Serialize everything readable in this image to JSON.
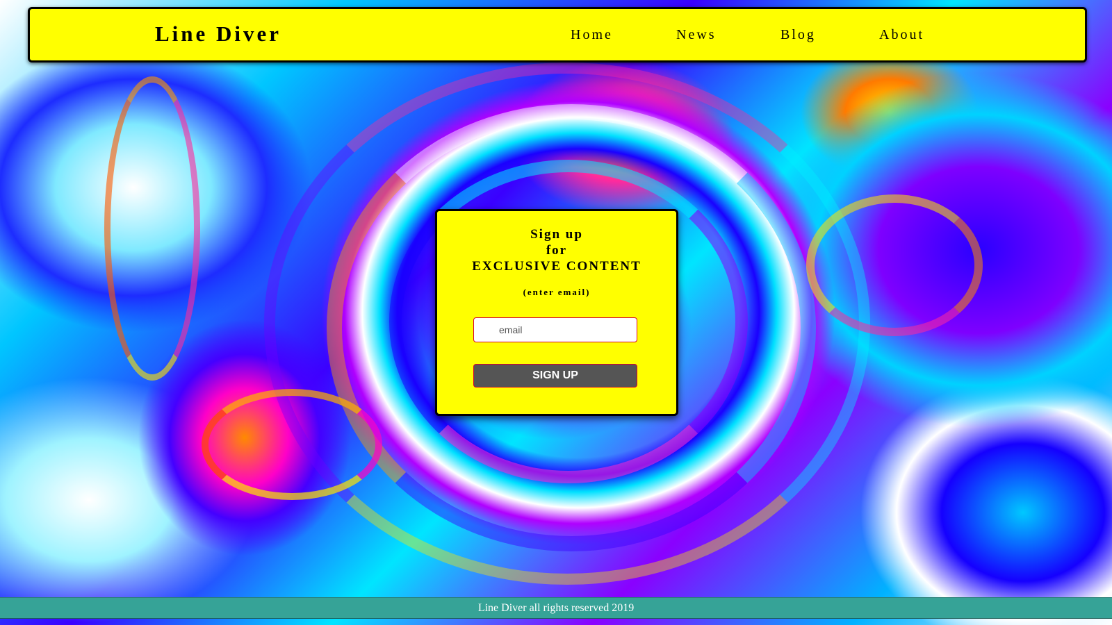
{
  "colors": {
    "navbar_bg": "#ffff00",
    "card_bg": "#ffff00",
    "button_bg": "#555555",
    "button_text": "#ffffff",
    "field_border": "#d8002f",
    "footer_bg": "#36a397",
    "footer_text": "#ffffff"
  },
  "background": {
    "description_icon": "psychedelic-swirl-background"
  },
  "navbar": {
    "brand": "Line Diver",
    "links": [
      {
        "label": "Home"
      },
      {
        "label": "News"
      },
      {
        "label": "Blog"
      },
      {
        "label": "About"
      }
    ]
  },
  "signup": {
    "heading_line1": "Sign up",
    "heading_line2": "for",
    "heading_line3": "EXCLUSIVE CONTENT",
    "hint": "(enter email)",
    "email_placeholder": "email",
    "email_value": "",
    "button_label": "SIGN UP"
  },
  "footer": {
    "text": "Line Diver all rights reserved 2019"
  }
}
